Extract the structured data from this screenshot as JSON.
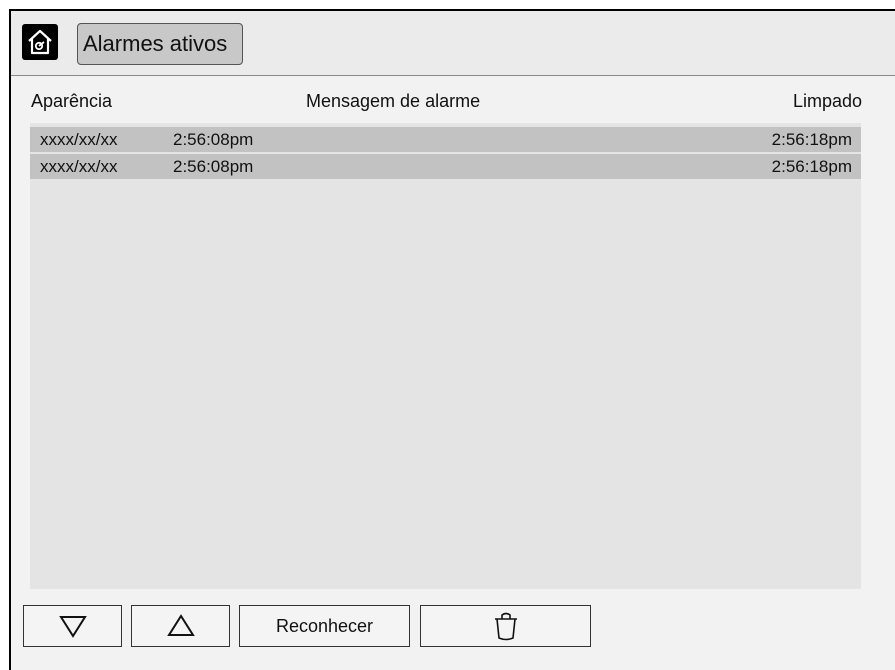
{
  "header": {
    "home_icon": "home-icon",
    "title": "Alarmes ativos"
  },
  "columns": {
    "appearance": "Aparência",
    "message": "Mensagem de alarme",
    "cleared": "Limpado"
  },
  "alarms": [
    {
      "date": "xxxx/xx/xx",
      "time": "2:56:08pm",
      "message": "",
      "cleared": "2:56:18pm"
    },
    {
      "date": "xxxx/xx/xx",
      "time": "2:56:08pm",
      "message": "",
      "cleared": "2:56:18pm"
    }
  ],
  "toolbar": {
    "down_icon": "triangle-down-icon",
    "up_icon": "triangle-up-icon",
    "acknowledge_label": "Reconhecer",
    "delete_icon": "trash-icon"
  }
}
